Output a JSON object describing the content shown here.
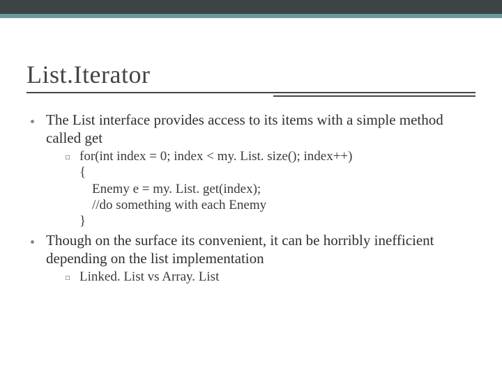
{
  "title": "List.Iterator",
  "bullets": [
    {
      "text": "The List interface provides access to its items with a simple method called get",
      "sub": [
        {
          "lines": [
            "for(int index = 0; index < my. List. size(); index++)",
            "{",
            "Enemy e = my. List. get(index);",
            "//do something with each Enemy",
            "}"
          ]
        }
      ]
    },
    {
      "text": "Though on the surface its convenient, it can be horribly inefficient depending on the list implementation",
      "sub": [
        {
          "lines": [
            "Linked. List vs Array. List"
          ]
        }
      ]
    }
  ]
}
